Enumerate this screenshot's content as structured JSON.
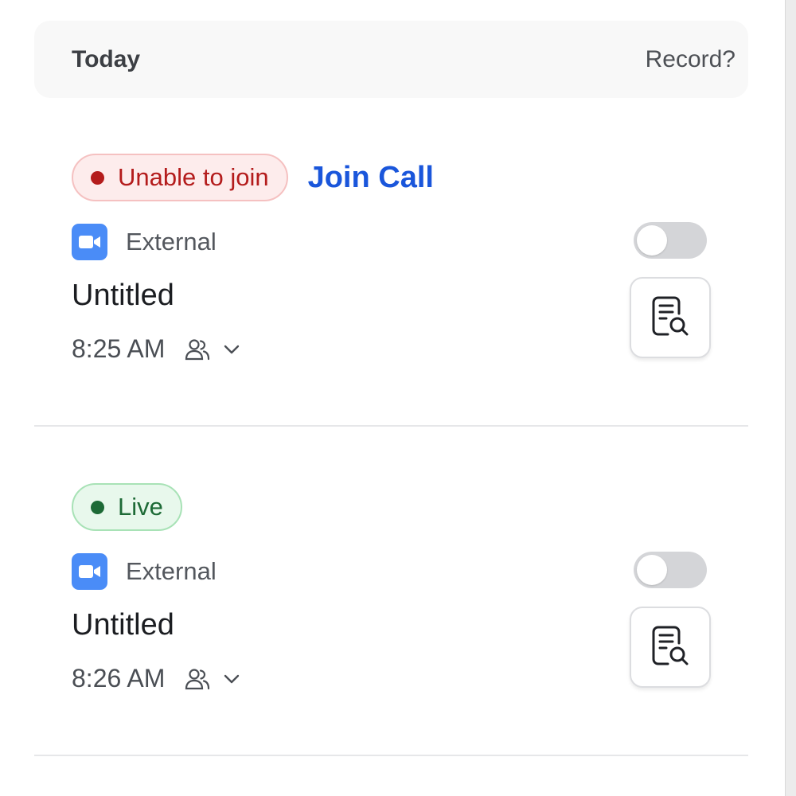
{
  "header": {
    "title": "Today",
    "record_label": "Record?"
  },
  "meetings": [
    {
      "status": "Unable to join",
      "status_color": "#b41c1c",
      "action_label": "Join Call",
      "source_icon": "zoom-video-icon",
      "source_label": "External",
      "recording_enabled": false,
      "title": "Untitled",
      "time": "8:25 AM",
      "attendees_icon": "people-icon",
      "expand_icon": "chevron-down-icon",
      "notes_icon": "document-search-icon"
    },
    {
      "status": "Live",
      "status_color": "#1d6a36",
      "source_icon": "zoom-video-icon",
      "source_label": "External",
      "recording_enabled": false,
      "title": "Untitled",
      "time": "8:26 AM",
      "attendees_icon": "people-icon",
      "expand_icon": "chevron-down-icon",
      "notes_icon": "document-search-icon"
    }
  ],
  "colors": {
    "link": "#1a56db",
    "zoom_blue": "#4a8cf7",
    "toggle_off": "#d4d5d8"
  }
}
